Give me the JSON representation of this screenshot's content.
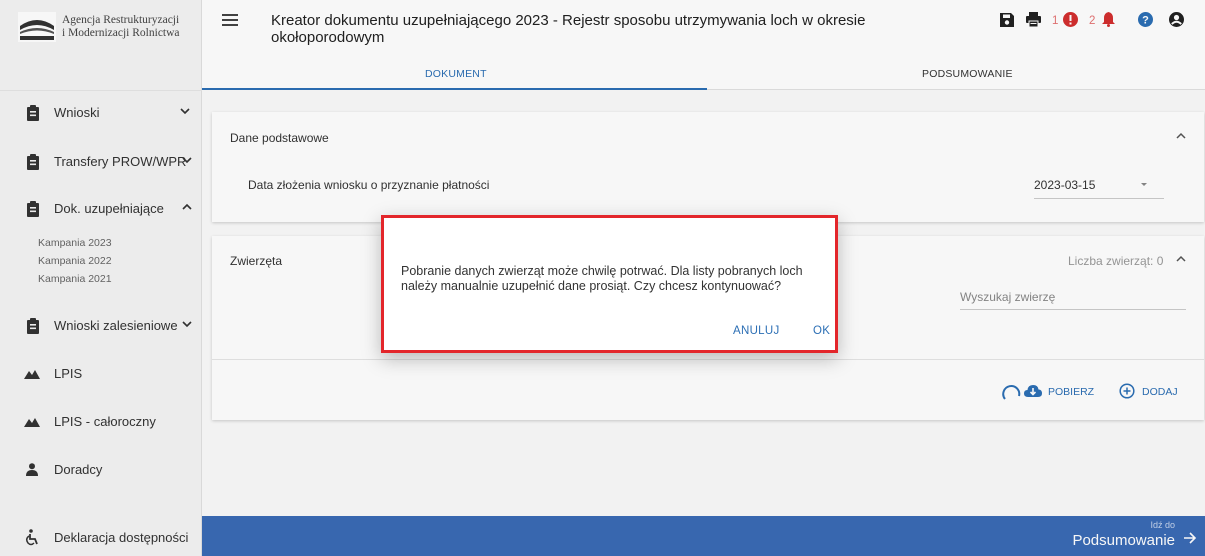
{
  "org": {
    "name_line1": "Agencja Restrukturyzacji",
    "name_line2": "i Modernizacji Rolnictwa"
  },
  "sidebar": {
    "items": [
      {
        "label": "Wnioski",
        "icon": "clipboard-icon",
        "expandable": true,
        "expanded": false
      },
      {
        "label": "Transfery PROW/WPR",
        "icon": "clipboard-icon",
        "expandable": true,
        "expanded": false
      },
      {
        "label": "Dok. uzupełniające",
        "icon": "clipboard-icon",
        "expandable": true,
        "expanded": true
      },
      {
        "label": "Wnioski zalesieniowe",
        "icon": "clipboard-icon",
        "expandable": true,
        "expanded": false
      },
      {
        "label": "LPIS",
        "icon": "mountains-icon",
        "expandable": false
      },
      {
        "label": "LPIS - całoroczny",
        "icon": "mountains-icon",
        "expandable": false
      },
      {
        "label": "Doradcy",
        "icon": "person-icon",
        "expandable": false
      },
      {
        "label": "Deklaracja dostępności",
        "icon": "accessibility-icon",
        "expandable": false
      }
    ],
    "sub_items": [
      "Kampania 2023",
      "Kampania 2022",
      "Kampania 2021"
    ]
  },
  "header": {
    "title": "Kreator dokumentu uzupełniającego 2023 - Rejestr sposobu utrzymywania loch w okresie okołoporodowym",
    "error_count": "1",
    "alert_count": "2"
  },
  "tabs": [
    {
      "label": "DOKUMENT",
      "active": true
    },
    {
      "label": "PODSUMOWANIE",
      "active": false
    }
  ],
  "basic": {
    "heading": "Dane podstawowe",
    "date_label": "Data złożenia wniosku o przyznanie płatności",
    "date_value": "2023-03-15"
  },
  "animals": {
    "heading": "Zwierzęta",
    "count_label": "Liczba zwierząt: 0",
    "search_placeholder": "Wyszukaj zwierzę",
    "fetch_label": "POBIERZ",
    "add_label": "DODAJ"
  },
  "footer": {
    "goto_small": "Idź do",
    "goto_big": "Podsumowanie"
  },
  "dialog": {
    "message": "Pobranie danych zwierząt może chwilę potrwać. Dla listy pobranych loch należy manualnie uzupełnić dane prosiąt. Czy chcesz kontynuować?",
    "cancel_label": "ANULUJ",
    "ok_label": "OK"
  },
  "colors": {
    "accent": "#2c6fb5",
    "bottom_bar": "#3a6bb5",
    "alert": "#e53935",
    "dialog_outline": "#e3262b"
  }
}
